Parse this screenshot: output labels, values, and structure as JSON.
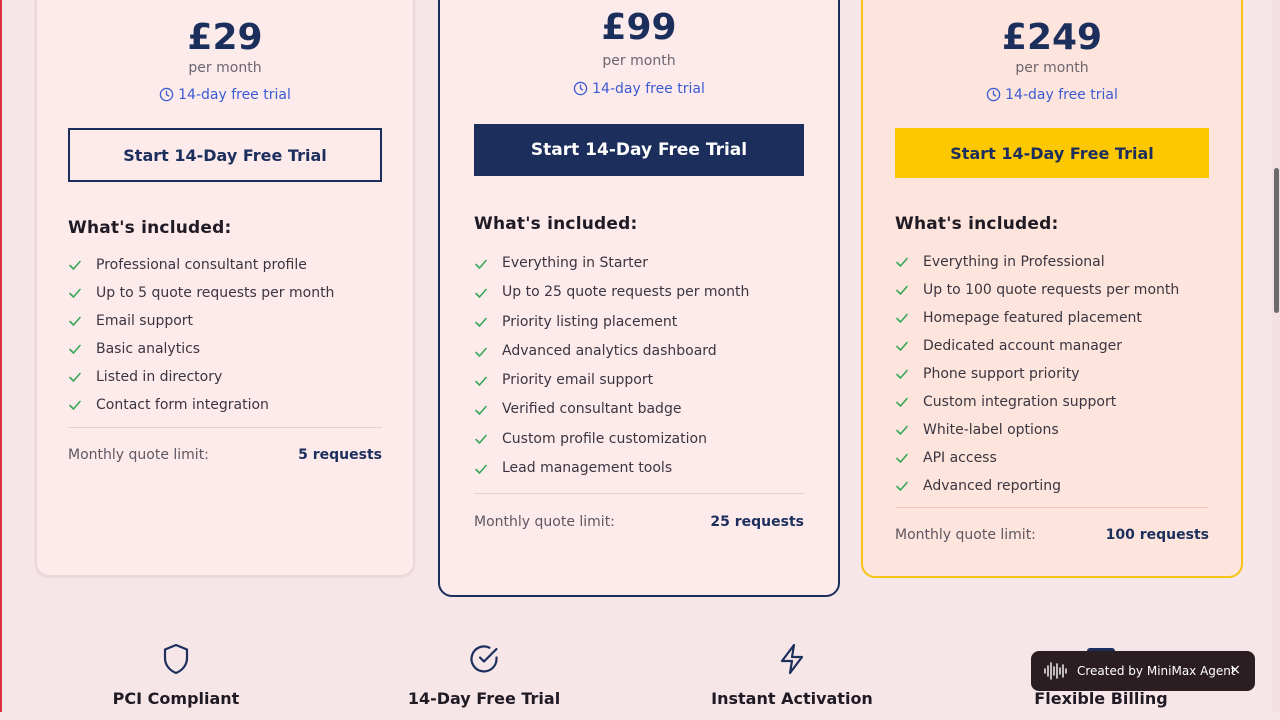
{
  "plans": [
    {
      "price": "£29",
      "period": "per month",
      "trial": "14-day free trial",
      "cta": "Start 14-Day Free Trial",
      "included_title": "What's included:",
      "features": [
        "Professional consultant profile",
        "Up to 5 quote requests per month",
        "Email support",
        "Basic analytics",
        "Listed in directory",
        "Contact form integration"
      ],
      "limit_label": "Monthly quote limit:",
      "limit_value": "5 requests"
    },
    {
      "price": "£99",
      "period": "per month",
      "trial": "14-day free trial",
      "cta": "Start 14-Day Free Trial",
      "included_title": "What's included:",
      "features": [
        "Everything in Starter",
        "Up to 25 quote requests per month",
        "Priority listing placement",
        "Advanced analytics dashboard",
        "Priority email support",
        "Verified consultant badge",
        "Custom profile customization",
        "Lead management tools"
      ],
      "limit_label": "Monthly quote limit:",
      "limit_value": "25 requests"
    },
    {
      "price": "£249",
      "period": "per month",
      "trial": "14-day free trial",
      "cta": "Start 14-Day Free Trial",
      "included_title": "What's included:",
      "features": [
        "Everything in Professional",
        "Up to 100 quote requests per month",
        "Homepage featured placement",
        "Dedicated account manager",
        "Phone support priority",
        "Custom integration support",
        "White-label options",
        "API access",
        "Advanced reporting"
      ],
      "limit_label": "Monthly quote limit:",
      "limit_value": "100 requests"
    }
  ],
  "badges": [
    {
      "label": "PCI Compliant",
      "icon": "shield-icon"
    },
    {
      "label": "14-Day Free Trial",
      "icon": "check-circle-icon"
    },
    {
      "label": "Instant Activation",
      "icon": "lightning-icon"
    },
    {
      "label": "Flexible Billing",
      "icon": "card-icon"
    }
  ],
  "toast": {
    "text": "Created by MiniMax Agent",
    "close": "×"
  },
  "colors": {
    "navy": "#1c2f5c",
    "yellow": "#fdc800",
    "check": "#3aa65a",
    "trial_blue": "#3b5bd3"
  }
}
